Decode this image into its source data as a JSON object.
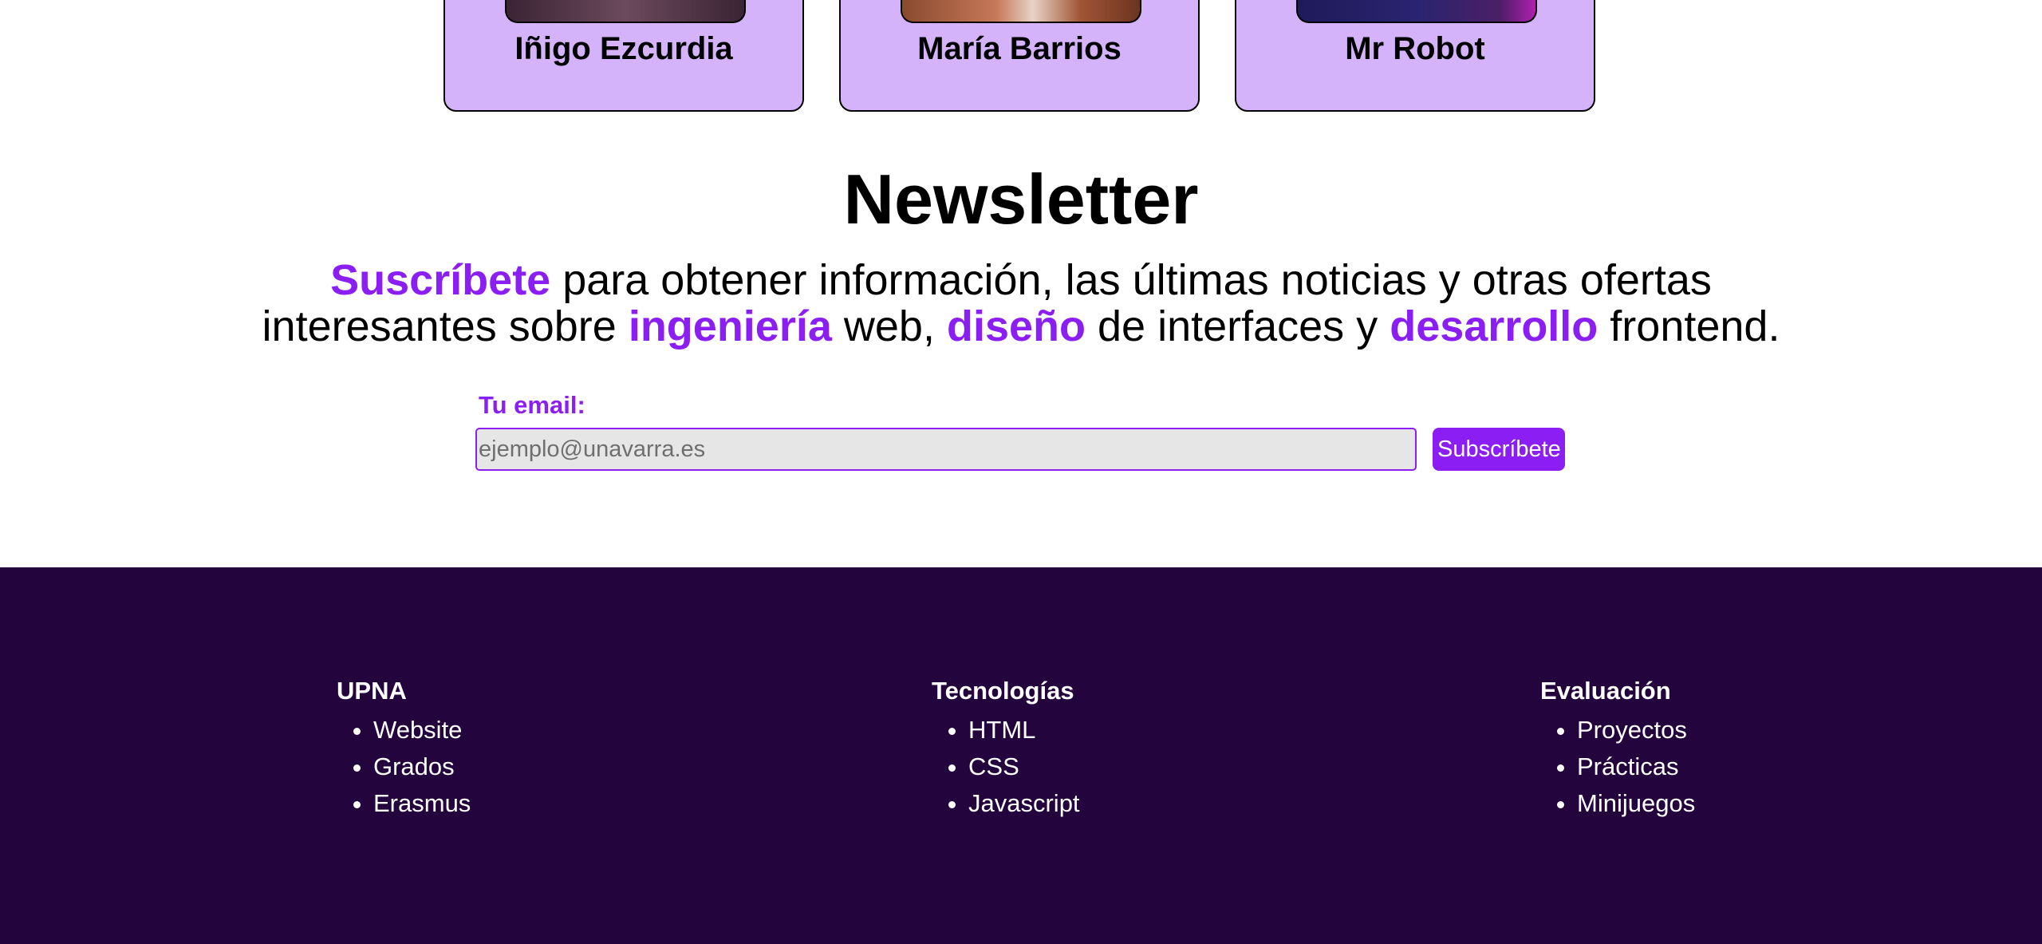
{
  "team": {
    "members": [
      {
        "name": "Iñigo Ezcurdia"
      },
      {
        "name": "María Barrios"
      },
      {
        "name": "Mr Robot"
      }
    ]
  },
  "newsletter": {
    "title": "Newsletter",
    "intro": {
      "w1": "Suscríbete",
      "t1": " para obtener información, las últimas noticias y otras ofertas interesantes sobre ",
      "w2": "ingeniería",
      "t2": " web, ",
      "w3": "diseño",
      "t3": " de interfaces y ",
      "w4": "desarrollo",
      "t4": " frontend."
    },
    "email_label": "Tu email:",
    "email_placeholder": "ejemplo@unavarra.es",
    "email_value": "",
    "submit_label": "Subscríbete"
  },
  "footer": {
    "columns": [
      {
        "title": "UPNA",
        "items": [
          "Website",
          "Grados",
          "Erasmus"
        ]
      },
      {
        "title": "Tecnologías",
        "items": [
          "HTML",
          "CSS",
          "Javascript"
        ]
      },
      {
        "title": "Evaluación",
        "items": [
          "Proyectos",
          "Prácticas",
          "Minijuegos"
        ]
      }
    ]
  },
  "colors": {
    "accent": "#8b1ff3",
    "card_bg": "#d4b3fb",
    "footer_bg": "#23043c"
  }
}
